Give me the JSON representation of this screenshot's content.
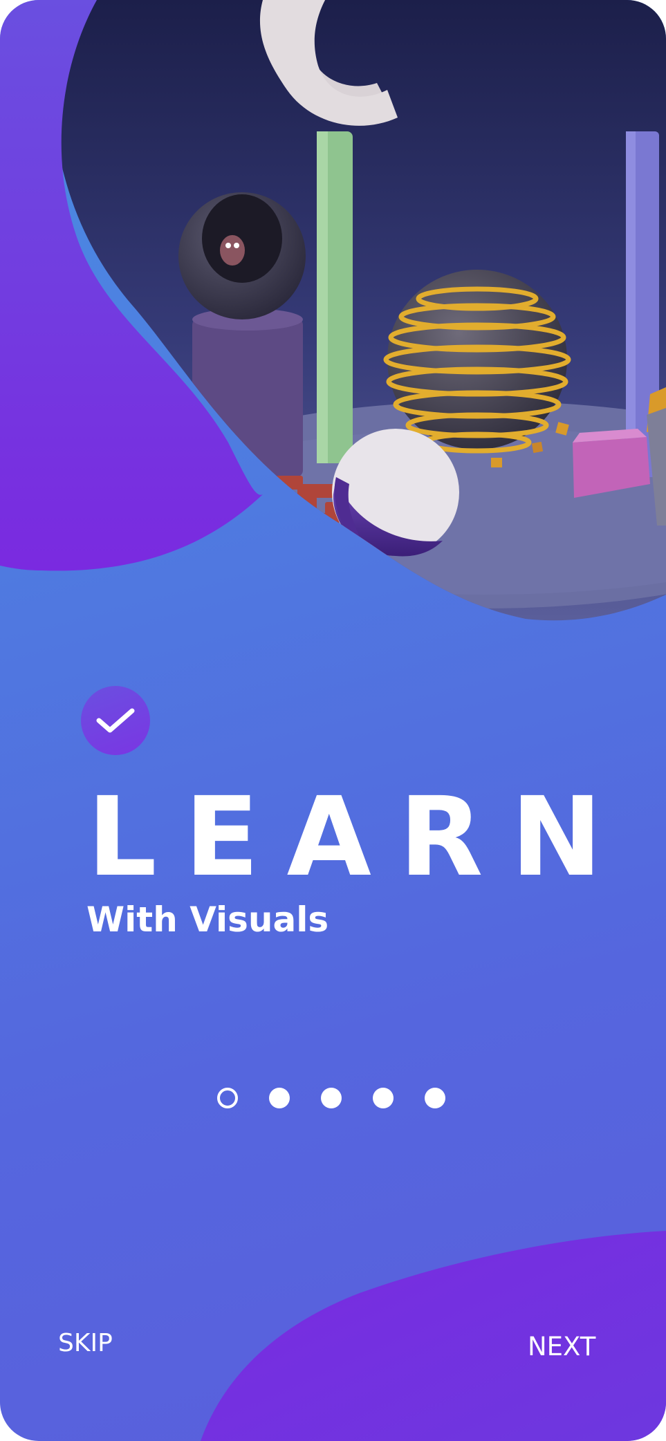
{
  "onboarding": {
    "title": "LEARN",
    "subtitle": "With Visuals",
    "pagination": {
      "total": 5,
      "active_index": 0
    },
    "skip_label": "SKIP",
    "next_label": "NEXT"
  },
  "icons": {
    "badge": "checkmark-icon"
  },
  "colors": {
    "background_top": "#4a8de2",
    "background_bottom": "#5a5fdc",
    "accent_purple": "#7a2fe0",
    "hero_navy": "#1f2352",
    "text": "#ffffff"
  }
}
